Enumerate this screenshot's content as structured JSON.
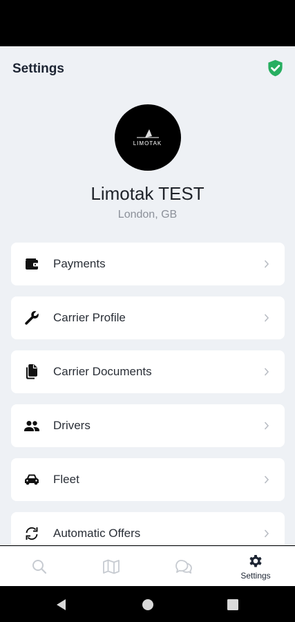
{
  "header": {
    "title": "Settings",
    "verified_icon": "shield-check-icon",
    "verified_color": "#27ae60"
  },
  "profile": {
    "logo_text": "LIMOTAK",
    "name": "Limotak TEST",
    "location": "London, GB"
  },
  "menu": [
    {
      "label": "Payments",
      "icon": "wallet-icon"
    },
    {
      "label": "Carrier Profile",
      "icon": "wrench-icon"
    },
    {
      "label": "Carrier Documents",
      "icon": "documents-icon"
    },
    {
      "label": "Drivers",
      "icon": "people-icon"
    },
    {
      "label": "Fleet",
      "icon": "car-icon"
    },
    {
      "label": "Automatic Offers",
      "icon": "refresh-icon"
    }
  ],
  "tabs": [
    {
      "icon": "search-icon",
      "label": ""
    },
    {
      "icon": "map-icon",
      "label": ""
    },
    {
      "icon": "chat-icon",
      "label": ""
    },
    {
      "icon": "gear-icon",
      "label": "Settings",
      "active": true
    }
  ],
  "colors": {
    "background": "#eef1f5",
    "active_tab": "#1d2533",
    "inactive_tab": "#c7cbd1"
  }
}
